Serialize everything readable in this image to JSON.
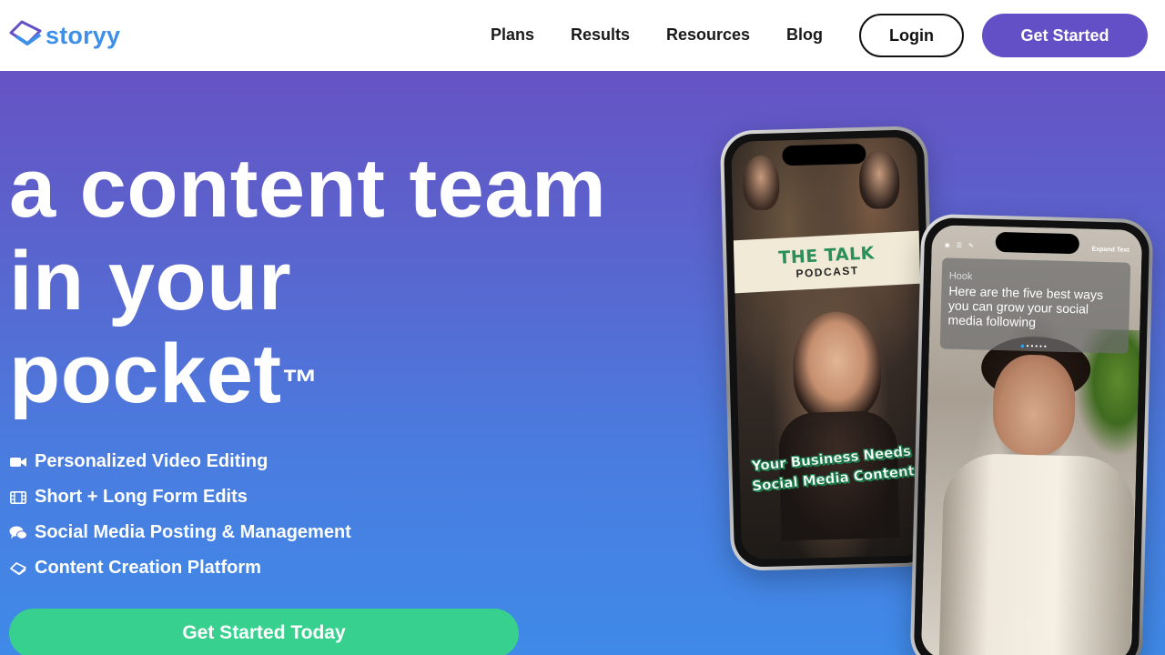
{
  "brand": {
    "name": "storyy",
    "logo_color": "#3e8fe8",
    "logo_accent": "#6450c6"
  },
  "nav": {
    "links": [
      "Plans",
      "Results",
      "Resources",
      "Blog"
    ],
    "login_label": "Login",
    "get_started_label": "Get Started"
  },
  "hero": {
    "headline_lines": [
      "a content team",
      "in your",
      "pocket"
    ],
    "trademark": "™",
    "features": [
      {
        "icon": "video-camera-icon",
        "label": "Personalized Video Editing"
      },
      {
        "icon": "film-strip-icon",
        "label": "Short + Long Form Edits"
      },
      {
        "icon": "chat-bubbles-icon",
        "label": "Social Media Posting & Management"
      },
      {
        "icon": "storyy-logo-icon",
        "label": "Content Creation Platform"
      }
    ],
    "cta_label": "Get Started Today"
  },
  "phone_left": {
    "banner_title": "THE TALK",
    "banner_subtitle": "PODCAST",
    "overlay_line1": "Your Business Needs",
    "overlay_line2": "Social Media Content"
  },
  "phone_right": {
    "topbar_action": "Expand Text",
    "hook_label": "Hook",
    "hook_text": "Here are the five best ways you can grow your social media following"
  },
  "colors": {
    "primary": "#6450c6",
    "cta_green": "#37d08f",
    "gradient_top": "#6653c4",
    "gradient_bottom": "#3f8ae8"
  }
}
